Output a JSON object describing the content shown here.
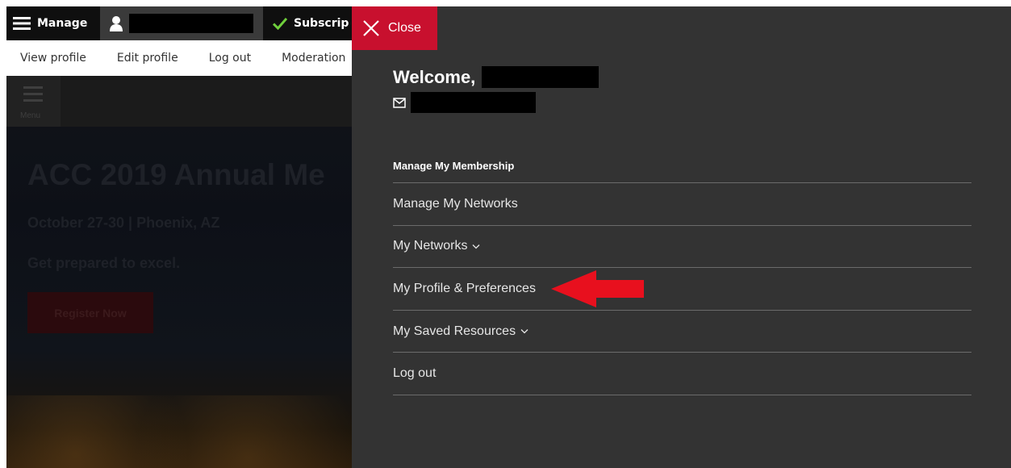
{
  "toolbar": {
    "manage_label": "Manage",
    "subscriptions_label": "Subscrip"
  },
  "secondary": {
    "items": [
      "View profile",
      "Edit profile",
      "Log out",
      "Moderation"
    ]
  },
  "hero": {
    "menu_label": "Menu",
    "title": "ACC 2019 Annual Me",
    "date": "October 27-30 | Phoenix, AZ",
    "tagline": "Get prepared to excel.",
    "register_label": "Register Now"
  },
  "panel": {
    "close_label": "Close",
    "welcome": "Welcome,",
    "heading": "Manage My Membership",
    "items": [
      {
        "label": "Manage My Networks"
      },
      {
        "label": "My Networks"
      },
      {
        "label": "My Profile & Preferences"
      },
      {
        "label": "My Saved Resources"
      },
      {
        "label": "Log out"
      }
    ]
  },
  "colors": {
    "accent_red": "#c8102e",
    "panel_bg": "#333333",
    "arrow_red": "#e8101e"
  },
  "icons": [
    "hamburger-icon",
    "user-icon",
    "checkmark-icon",
    "close-icon",
    "envelope-icon",
    "chevron-down-icon",
    "red-arrow-annotation"
  ]
}
